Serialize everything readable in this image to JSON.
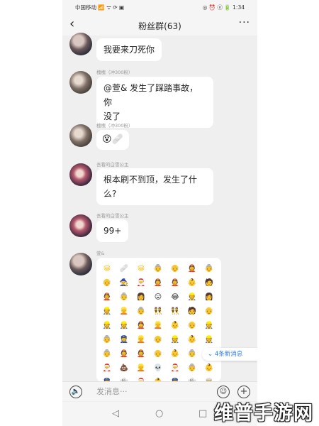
{
  "status_bar": {
    "carrier": "中国移动 📶 ᯤ ⟳ ▣",
    "right": "◎ ⏰ ⓝ 🔋 1:34"
  },
  "header": {
    "back": "‹",
    "title": "粉丝群(63)",
    "more": "···"
  },
  "messages": [
    {
      "sender": "",
      "text": "我要来刀死你"
    },
    {
      "sender": "槐槐（冲300粉）",
      "text_line1": "@萱& 发生了踩踏事故，你",
      "text_line2": "没了"
    },
    {
      "sender": "槐槐（冲300粉）",
      "text": "😵🩹"
    },
    {
      "sender": "吾看的白雪公主",
      "text_line1": "根本刷不到顶，发生了什",
      "text_line2": "么?"
    },
    {
      "sender": "吾看的白雪公主",
      "text": "99+"
    },
    {
      "sender": "萱&"
    }
  ],
  "emoji_bubble": {
    "rows": [
      [
        "😀",
        "🩹",
        "😀",
        "👵",
        "👴",
        "👲",
        "👵"
      ],
      [
        "👴",
        "🧙",
        "🎅",
        "👲",
        "👲",
        "👶",
        "🧑"
      ],
      [
        "👲",
        "👵",
        "👩",
        "😛",
        "😂",
        "👷",
        "👩"
      ],
      [
        "👷",
        "👱",
        "👵",
        "👯",
        "👯",
        "🧑",
        "👴"
      ],
      [
        "👷",
        "👷",
        "👲",
        "👱",
        "👶",
        "👴",
        "👷"
      ],
      [
        "👵",
        "👮",
        "👱",
        "👴",
        "👷",
        "👶",
        "👷"
      ],
      [
        "👵",
        "👲",
        "👲",
        "👴",
        "👶",
        "👵",
        "👷"
      ],
      [
        "🎅",
        "💩",
        "👱",
        "💀",
        "🎅",
        "👵",
        "👶"
      ],
      [
        "👮",
        "👻",
        "🎅",
        "👶",
        "👮",
        "👻",
        "👳"
      ]
    ]
  },
  "new_message_hint": "⌄ 4条新消息",
  "input_bar": {
    "voice_icon": "🔈",
    "placeholder": "发消息···",
    "emoji_icon": "☺",
    "plus_icon": "+"
  },
  "system_nav": {
    "back": "◁",
    "home": "○",
    "recent": "□"
  },
  "watermark": "维普手游网",
  "colors": {
    "bubble": "#ffffff",
    "background": "#efefef",
    "link": "#2f7de1",
    "emoji_yellow": "#f3c21c"
  }
}
